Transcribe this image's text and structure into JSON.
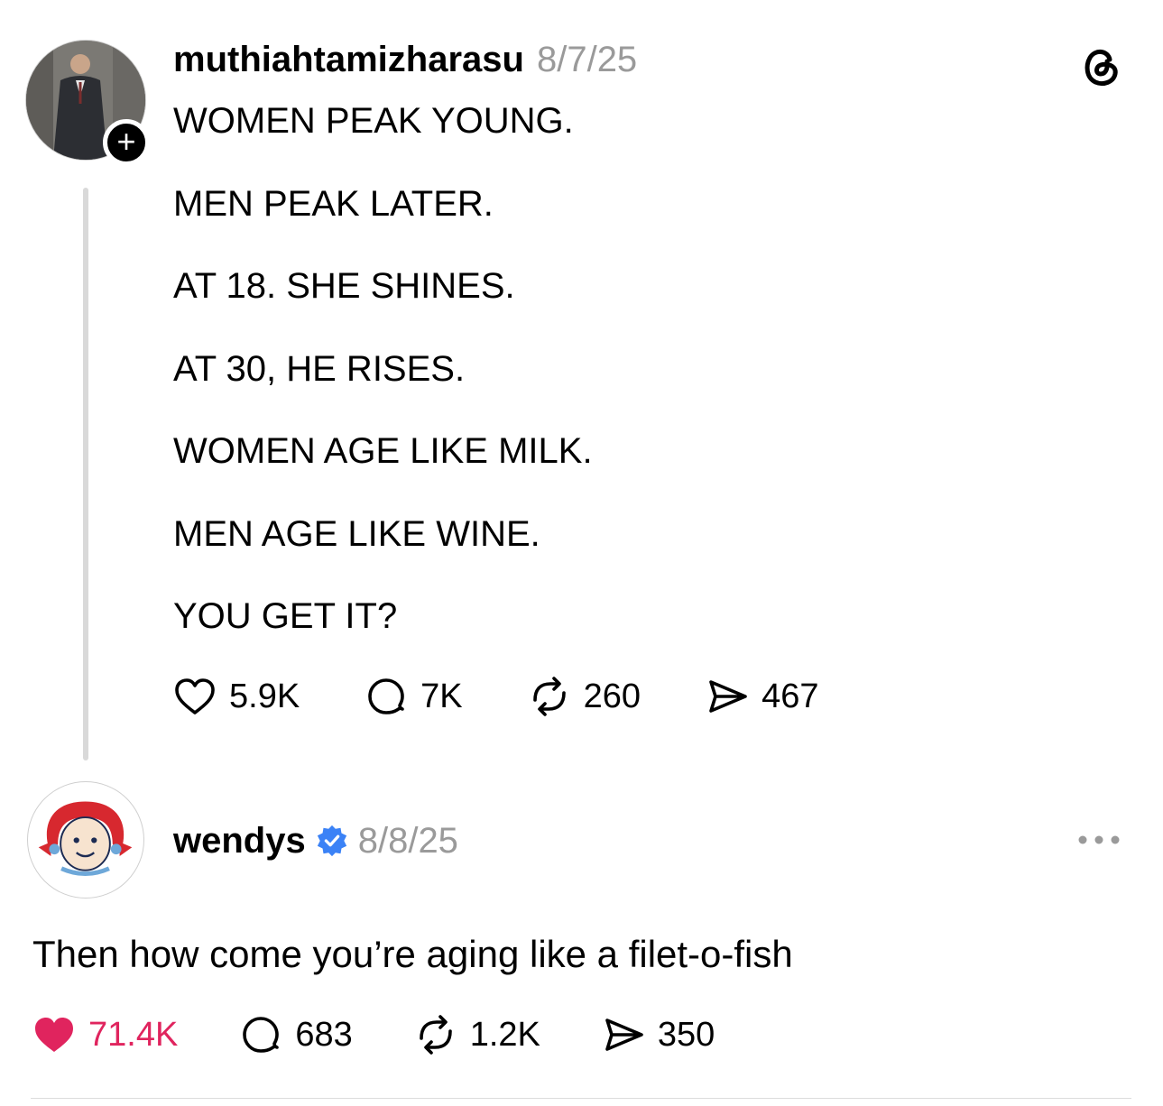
{
  "post": {
    "username": "muthiahtamizharasu",
    "date": "8/7/25",
    "lines": [
      "WOMEN PEAK YOUNG.",
      "MEN PEAK LATER.",
      "AT 18. SHE SHINES.",
      "AT 30, HE RISES.",
      "WOMEN AGE LIKE MILK.",
      "MEN AGE LIKE WINE.",
      "YOU GET IT?"
    ],
    "likes": "5.9K",
    "replies": "7K",
    "reposts": "260",
    "shares": "467",
    "follow_symbol": "+"
  },
  "reply": {
    "username": "wendys",
    "date": "8/8/25",
    "text": "Then how come you’re aging like a filet-o-fish",
    "likes": "71.4K",
    "replies": "683",
    "reposts": "1.2K",
    "shares": "350",
    "liked": true,
    "verified": true
  },
  "icons": {
    "app_logo": "threads-logo-icon",
    "like": "heart-icon",
    "reply": "speech-bubble-icon",
    "repost": "repost-icon",
    "share": "send-icon",
    "more": "more-options-icon",
    "verified": "verified-badge-icon"
  },
  "colors": {
    "liked": "#e0245e",
    "verified": "#3b82f6",
    "timestamp": "#9a9a9a",
    "thread_line": "#d9d9d9"
  }
}
